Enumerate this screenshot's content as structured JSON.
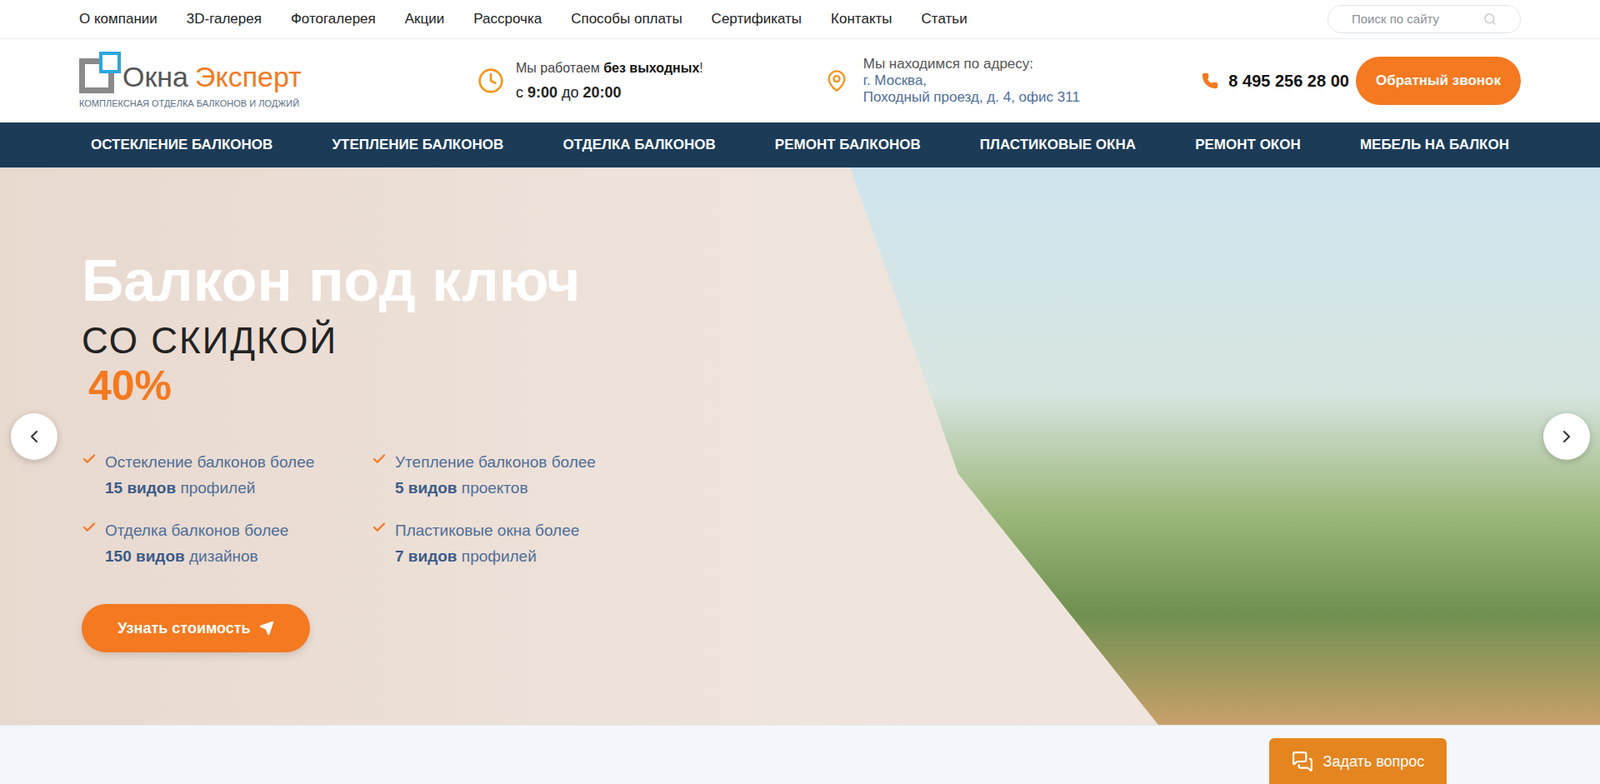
{
  "top_nav": {
    "items": [
      "О компании",
      "3D-галерея",
      "Фотогалерея",
      "Акции",
      "Рассрочка",
      "Способы оплаты",
      "Сертификаты",
      "Контакты",
      "Статьи"
    ],
    "search": {
      "placeholder": "Поиск по сайту"
    }
  },
  "header": {
    "logo": {
      "word1": "Окна",
      "word2": "Эксперт",
      "tagline": "КОМПЛЕКСНАЯ ОТДЕЛКА БАЛКОНОВ И ЛОДЖИЙ"
    },
    "hours": {
      "prefix": "Мы работаем ",
      "bold": "без выходных",
      "suffix": "!",
      "from_word": "с ",
      "from": "9:00",
      "to_word": " до ",
      "to": "20:00"
    },
    "address": {
      "label": "Мы находимся по адресу:",
      "city": "г. Москва,",
      "street": "Походный проезд, д. 4, офис 311"
    },
    "phone": "8 495 256 28 00",
    "callback_button": "Обратный звонок"
  },
  "main_nav": {
    "items": [
      "ОСТЕКЛЕНИЕ БАЛКОНОВ",
      "УТЕПЛЕНИЕ БАЛКОНОВ",
      "ОТДЕЛКА БАЛКОНОВ",
      "РЕМОНТ БАЛКОНОВ",
      "ПЛАСТИКОВЫЕ ОКНА",
      "РЕМОНТ ОКОН",
      "МЕБЕЛЬ НА БАЛКОН"
    ]
  },
  "hero": {
    "title": "Балкон под ключ",
    "subtitle": "СО СКИДКОЙ",
    "discount": "40%",
    "features": [
      {
        "line": "Остекление балконов более",
        "bold": "15 видов",
        "rest": " профилей"
      },
      {
        "line": "Утепление балконов более",
        "bold": "5 видов",
        "rest": " проектов"
      },
      {
        "line": "Отделка балконов более",
        "bold": "150 видов",
        "rest": " дизайнов"
      },
      {
        "line": "Пластиковые окна более",
        "bold": "7 видов",
        "rest": " профилей"
      }
    ],
    "button": "Узнать стоимость"
  },
  "chat_button": "Задать вопрос"
}
